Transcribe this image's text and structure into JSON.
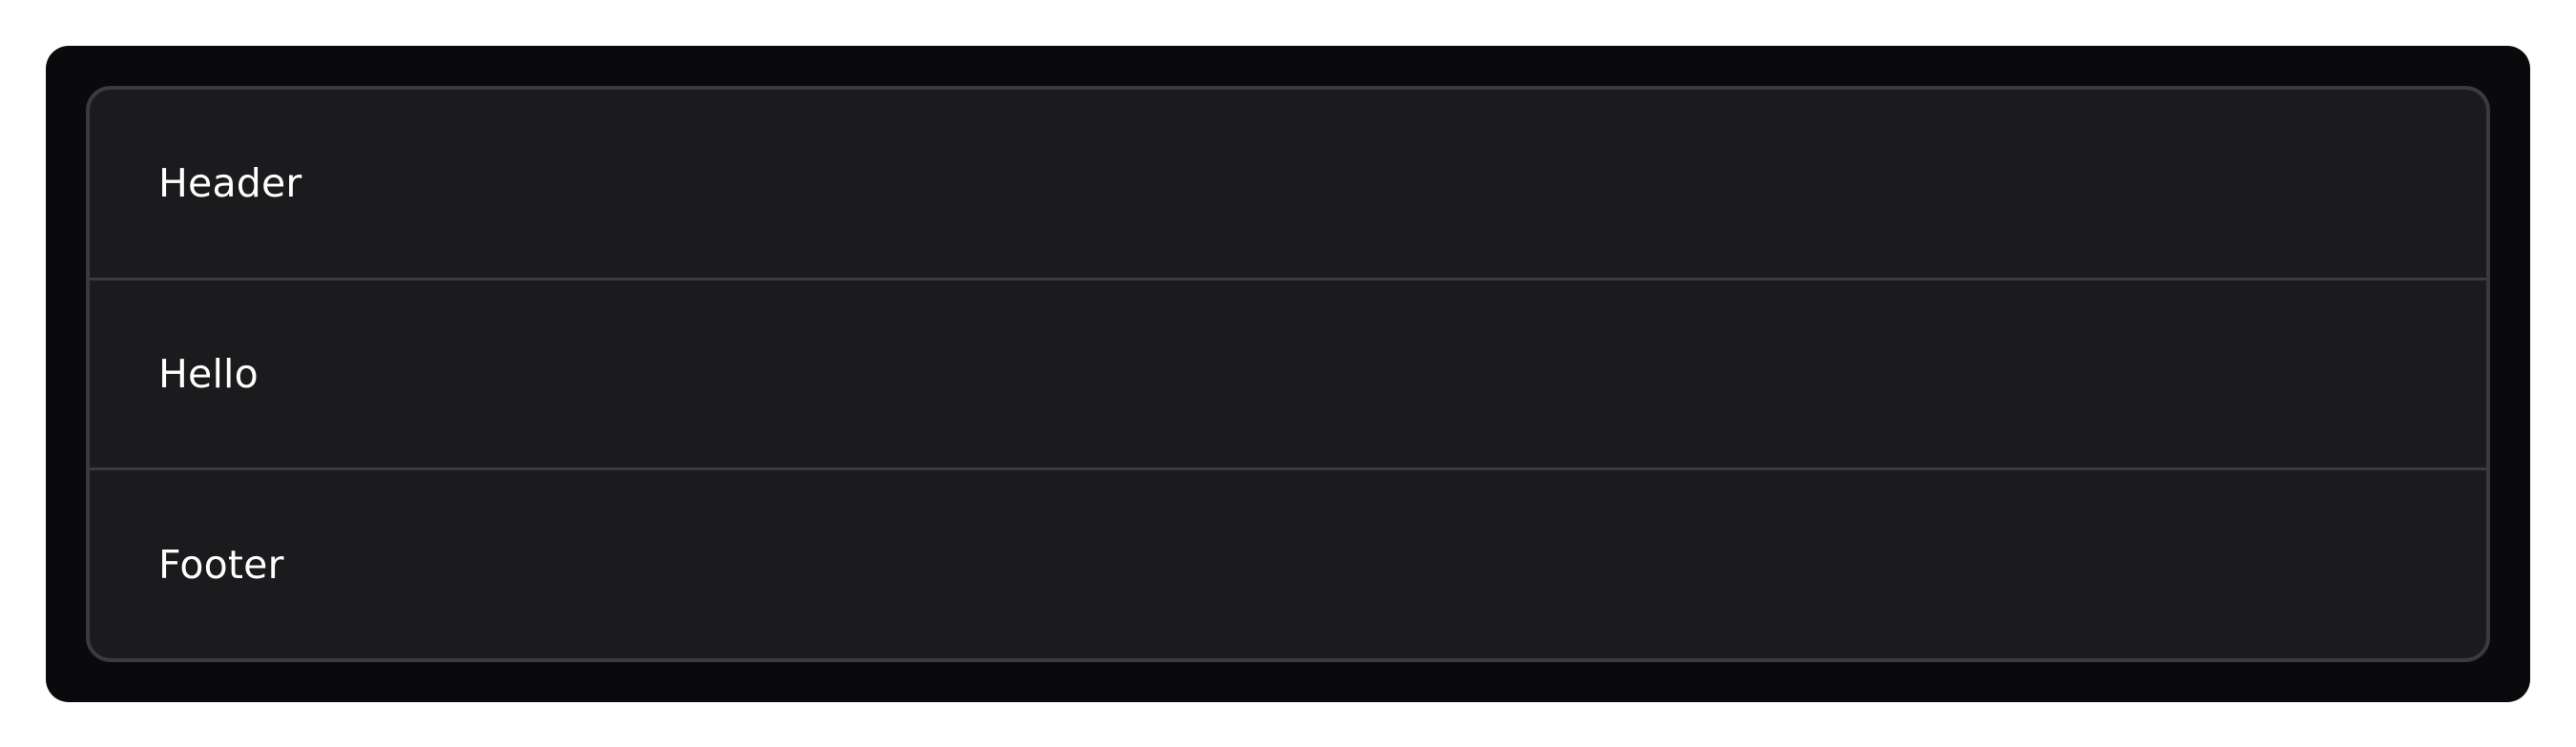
{
  "card": {
    "header": "Header",
    "body": "Hello",
    "footer": "Footer"
  },
  "colors": {
    "page_background": "#ffffff",
    "frame_background": "#0a0a0c",
    "card_background": "#1b1b1d",
    "card_border": "#3b3b3f",
    "text": "#ffffff"
  }
}
